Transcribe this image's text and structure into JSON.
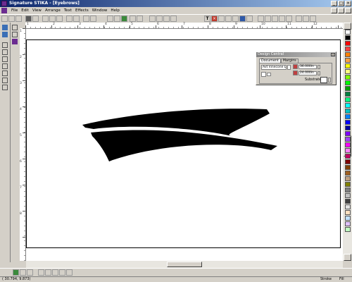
{
  "window": {
    "title": "Signature STIKA - [Eyebrows]",
    "minimize": "_",
    "maximize": "□",
    "close": "×"
  },
  "menu": [
    "File",
    "Edit",
    "View",
    "Arrange",
    "Text",
    "Effects",
    "Window",
    "Help"
  ],
  "ruler": {
    "h_ticks": [
      "1",
      "2",
      "3",
      "4",
      "5",
      "6",
      "7",
      "8",
      "9",
      "10",
      "11",
      "12"
    ],
    "v_ticks": [
      "1",
      "2",
      "3",
      "4",
      "5",
      "6",
      "7",
      "8"
    ]
  },
  "design_central": {
    "title": "Design Central",
    "close": "×",
    "tabs": [
      "Document",
      "Margins"
    ],
    "media_select": "Avt Vinecone D",
    "width": "36.000in",
    "height": "24.000in",
    "substrate_label": "Substrate"
  },
  "palette": [
    "#ffffff",
    "#000000",
    "#ff0000",
    "#ff4040",
    "#ff8000",
    "#ffa040",
    "#ffff00",
    "#ffff80",
    "#80ff00",
    "#00ff00",
    "#00a000",
    "#008040",
    "#00ff80",
    "#00ffff",
    "#00c0c0",
    "#0080ff",
    "#0000ff",
    "#0000a0",
    "#8000ff",
    "#a040ff",
    "#ff00ff",
    "#ff80ff",
    "#c00060",
    "#800000",
    "#804000",
    "#a06020",
    "#c0a080",
    "#808000",
    "#808080",
    "#c0c0c0",
    "#404040",
    "#e0e0e0",
    "#ffe0c0",
    "#c0e0ff",
    "#e0c0ff",
    "#c0ffc0"
  ],
  "status": {
    "coords": "( 30.794, 9.873)",
    "zoom": "Stroke",
    "units": "Fill"
  }
}
